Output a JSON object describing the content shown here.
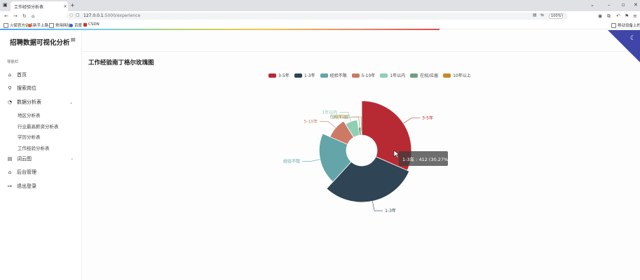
{
  "browser": {
    "tab_title": "工作经验分析表",
    "tab_close": "×",
    "new_tab": "+",
    "url_host": "127.0.0.1",
    "url_path": ":5000/experience",
    "zoom": "100%",
    "bookmarks": [
      "火狐官方站点",
      "新手上路",
      "常用网址",
      "百度",
      "CSDN"
    ],
    "mobile_bookmarks": "移动设备上的书签"
  },
  "sidebar": {
    "brand": "招聘数据可视化分析",
    "nav_label": "导航栏",
    "items": [
      {
        "label": "首页",
        "icon": "home-icon"
      },
      {
        "label": "搜索岗位",
        "icon": "search-icon"
      },
      {
        "label": "数据分析表",
        "icon": "pie-icon"
      },
      {
        "label": "词云图",
        "icon": "cloud-icon"
      },
      {
        "label": "后台管理",
        "icon": "bank-icon"
      },
      {
        "label": "退出登录",
        "icon": "logout-icon"
      }
    ],
    "subitems": [
      "地区分析表",
      "行业最高薪资分析表",
      "学历分析表",
      "工作经验分析表"
    ]
  },
  "main": {
    "title": "工作经验南丁格尔玫瑰图"
  },
  "chart_data": {
    "type": "pie",
    "subtype": "nightingale-rose",
    "categories": [
      "3-5年",
      "1-3年",
      "经验不限",
      "5-10年",
      "1年以内",
      "在校/应届",
      "10年以上"
    ],
    "colors": [
      "#b82a33",
      "#2f4454",
      "#63a5a8",
      "#cc7a66",
      "#8fcfb5",
      "#6e9f81",
      "#c78a28"
    ],
    "values": [
      430,
      412,
      268,
      133,
      88,
      23,
      8
    ],
    "highlight_index": 1,
    "tooltip": "1-3年 : 412 (30.27%)",
    "legend_position": "top-center"
  }
}
